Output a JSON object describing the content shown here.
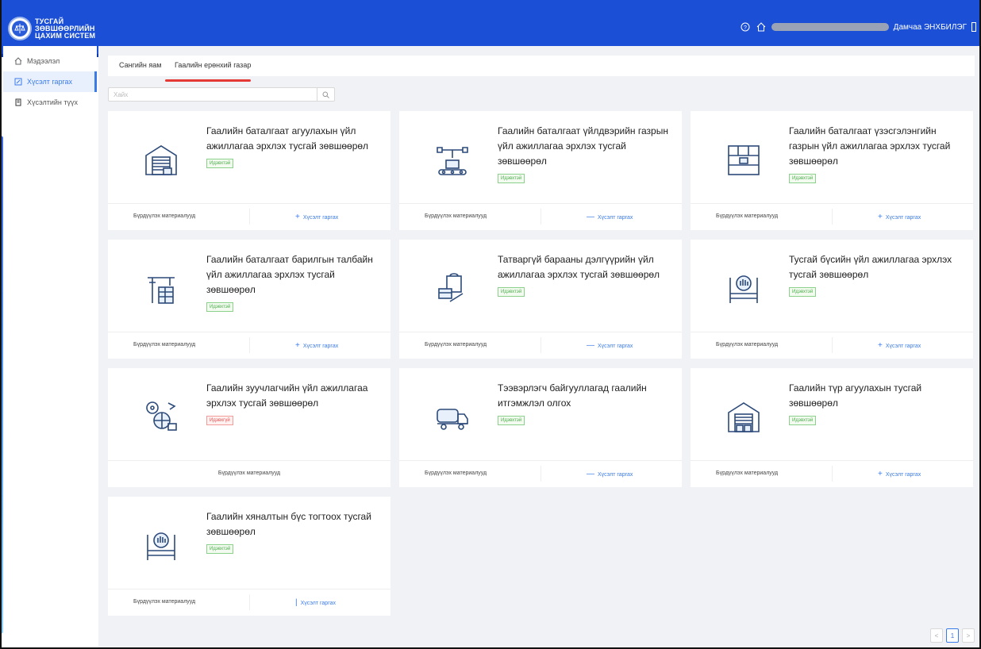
{
  "header": {
    "logo_lines": [
      "ТУСГАЙ",
      "ЗӨВШӨӨРЛИЙН",
      "ЦАХИМ СИСТЕМ"
    ],
    "user_name": "Дамчаа ЭНХБИЛЭГ",
    "icons": [
      "help-icon",
      "home-icon",
      "logout-icon"
    ]
  },
  "sidebar": {
    "items": [
      {
        "label": "Мэдээлэл",
        "icon": "home-icon"
      },
      {
        "label": "Хүсэлт гаргах",
        "icon": "edit-icon"
      },
      {
        "label": "Хүсэлтийн түүх",
        "icon": "history-icon"
      }
    ]
  },
  "tabs": [
    {
      "label": "Сангийн яам"
    },
    {
      "label": "Гаалийн ерөнхий газар"
    }
  ],
  "search": {
    "placeholder": "Хайх"
  },
  "cards": [
    {
      "title": "Гаалийн баталгаат агуулахын үйл ажиллагаа эрхлэх тусгай зөвшөөрөл",
      "status": "Идэвхтэй",
      "foot_left": "Бүрдүүлэх материалууд",
      "action": "Хүсэлт гаргах",
      "action_mark": "+",
      "icon": "warehouse-icon"
    },
    {
      "title": "Гаалийн баталгаат үйлдвэрийн газрын үйл ажиллагаа эрхлэх тусгай зөвшөөрөл",
      "status": "Идэвхтэй",
      "foot_left": "Бүрдүүлэх материалууд",
      "action": "Хүсэлт гаргах",
      "action_mark": "—",
      "icon": "factory-conveyor-icon"
    },
    {
      "title": "Гаалийн баталгаат үзэсгэлэнгийн газрын үйл ажиллагаа эрхлэх тусгай зөвшөөрөл",
      "status": "Идэвхтэй",
      "foot_left": "Бүрдүүлэх материалууд",
      "action": "Хүсэлт гаргах",
      "action_mark": "+",
      "icon": "shelves-icon"
    },
    {
      "title": "Гаалийн баталгаат барилгын талбайн үйл ажиллагаа эрхлэх тусгай зөвшөөрөл",
      "status": "Идэвхтэй",
      "foot_left": "Бүрдүүлэх материалууд",
      "action": "Хүсэлт гаргах",
      "action_mark": "+",
      "icon": "construction-crane-icon"
    },
    {
      "title": "Татваргүй барааны дэлгүүрийн үйл ажиллагаа эрхлэх тусгай зөвшөөрөл",
      "status": "Идэвхтэй",
      "foot_left": "Бүрдүүлэх материалууд",
      "action": "Хүсэлт гаргах",
      "action_mark": "—",
      "icon": "shopping-bag-icon"
    },
    {
      "title": "Тусгай бүсийн үйл ажиллагаа эрхлэх тусгай зөвшөөрөл",
      "status": "Идэвхтэй",
      "foot_left": "Бүрдүүлэх материалууд",
      "action": "Хүсэлт гаргах",
      "action_mark": "+",
      "icon": "barrier-hand-icon"
    },
    {
      "title": "Гаалийн зуучлагчийн үйл ажиллагаа эрхлэх тусгай зөвшөөрөл",
      "status": "Идэвхгүй",
      "status_type": "inactive",
      "foot_center": "Бүрдүүлэх материалууд",
      "icon": "logistics-globe-icon"
    },
    {
      "title": "Тээвэрлэгч байгууллагад гаалийн итгэмжлэл олгох",
      "status": "Идэвхтэй",
      "foot_left": "Бүрдүүлэх материалууд",
      "action": "Хүсэлт гаргах",
      "action_mark": "—",
      "icon": "tanker-truck-icon"
    },
    {
      "title": "Гаалийн түр агуулахын тусгай зөвшөөрөл",
      "status": "Идэвхтэй",
      "foot_left": "Бүрдүүлэх материалууд",
      "action": "Хүсэлт гаргах",
      "action_mark": "+",
      "icon": "warehouse-icon"
    },
    {
      "title": "Гаалийн хяналтын бүс тогтоох тусгай зөвшөөрөл",
      "status": "Идэвхтэй",
      "foot_left": "Бүрдүүлэх материалууд",
      "action": "Хүсэлт гаргах",
      "action_mark": "|",
      "icon": "barrier-hand-icon"
    }
  ],
  "pagination": {
    "prev": "<",
    "current": "1",
    "next": ">"
  },
  "colors": {
    "header": "#1a4fd6",
    "accent": "#3b7be8",
    "active_badge": "#4cae4c",
    "inactive_badge": "#e05252",
    "tab_underline": "#e53935"
  }
}
